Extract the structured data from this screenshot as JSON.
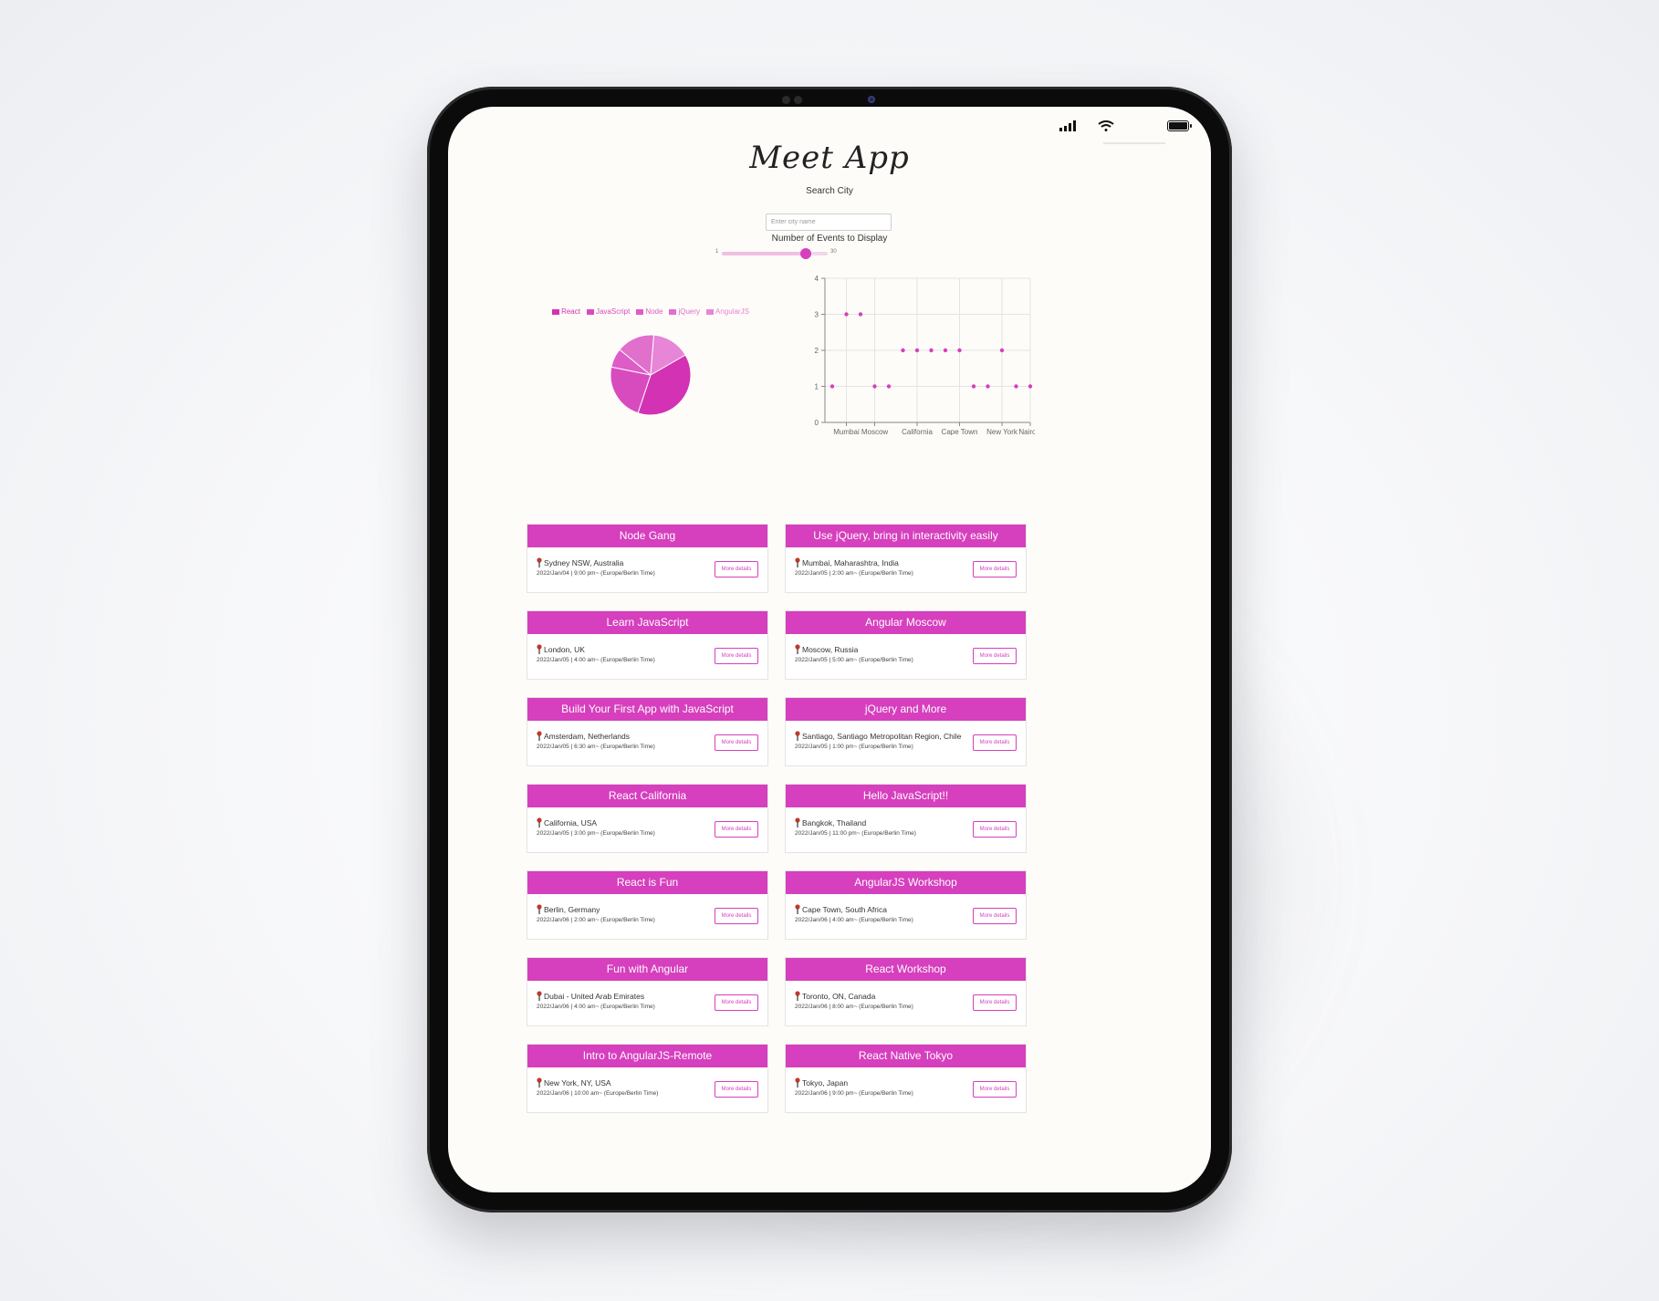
{
  "app": {
    "title": "Meet App"
  },
  "search": {
    "label": "Search City",
    "placeholder": "Enter city name"
  },
  "events_count": {
    "label": "Number of Events to Display",
    "min": "1",
    "max": "30",
    "value": 24
  },
  "colors": {
    "accent": "#d63fbd",
    "accent_light": "#efc0e2"
  },
  "chart_data": [
    {
      "type": "pie",
      "legend_position": "top",
      "categories": [
        "React",
        "JavaScript",
        "Node",
        "jQuery",
        "AngularJS"
      ],
      "values": [
        5,
        3,
        1,
        2,
        2
      ],
      "colors": [
        "#d232b3",
        "#d84bbf",
        "#dd5cc6",
        "#e16fcc",
        "#e785d6"
      ]
    },
    {
      "type": "scatter",
      "xlabel": "",
      "ylabel": "",
      "ylim": [
        0,
        4
      ],
      "yticks": [
        "0",
        "1",
        "2",
        "3",
        "4"
      ],
      "x": [
        "Sydney",
        "Mumbai",
        "Amsterdam",
        "Moscow",
        "Santiago",
        "California",
        "Berlin",
        "Bangkok",
        "Dubai",
        "Cape Town",
        "Toronto",
        "Tokyo",
        "New York",
        "London",
        "Nairobi"
      ],
      "xtick_labels": [
        {
          "index": 1,
          "label": "Mumbai"
        },
        {
          "index": 3,
          "label": "Moscow"
        },
        {
          "index": 6,
          "label": "California"
        },
        {
          "index": 9,
          "label": "Cape Town"
        },
        {
          "index": 12,
          "label": "New York"
        },
        {
          "index": 14,
          "label": "Nairobi"
        }
      ],
      "y": [
        1,
        3,
        3,
        1,
        1,
        2,
        2,
        2,
        2,
        2,
        1,
        1,
        2,
        1,
        1
      ],
      "grid": true
    }
  ],
  "events": [
    {
      "title": "Node Gang",
      "location": "Sydney NSW, Australia",
      "time": "2022/Jan/04 | 9:00 pm~ (Europe/Berlin Time)",
      "button": "More details"
    },
    {
      "title": "Use jQuery, bring in interactivity easily",
      "location": "Mumbai, Maharashtra, India",
      "time": "2022/Jan/05 | 2:00 am~ (Europe/Berlin Time)",
      "button": "More details"
    },
    {
      "title": "Learn JavaScript",
      "location": "London, UK",
      "time": "2022/Jan/05 | 4:00 am~ (Europe/Berlin Time)",
      "button": "More details"
    },
    {
      "title": "Angular Moscow",
      "location": "Moscow, Russia",
      "time": "2022/Jan/05 | 5:00 am~ (Europe/Berlin Time)",
      "button": "More details"
    },
    {
      "title": "Build Your First App with JavaScript",
      "location": "Amsterdam, Netherlands",
      "time": "2022/Jan/05 | 6:30 am~ (Europe/Berlin Time)",
      "button": "More details"
    },
    {
      "title": "jQuery and More",
      "location": "Santiago, Santiago Metropolitan Region, Chile",
      "time": "2022/Jan/05 | 1:00 pm~ (Europe/Berlin Time)",
      "button": "More details"
    },
    {
      "title": "React California",
      "location": "California, USA",
      "time": "2022/Jan/05 | 3:00 pm~ (Europe/Berlin Time)",
      "button": "More details"
    },
    {
      "title": "Hello JavaScript!!",
      "location": "Bangkok, Thailand",
      "time": "2022/Jan/05 | 11:00 pm~ (Europe/Berlin Time)",
      "button": "More details"
    },
    {
      "title": "React is Fun",
      "location": "Berlin, Germany",
      "time": "2022/Jan/06 | 2:00 am~ (Europe/Berlin Time)",
      "button": "More details"
    },
    {
      "title": "AngularJS Workshop",
      "location": "Cape Town, South Africa",
      "time": "2022/Jan/06 | 4:00 am~ (Europe/Berlin Time)",
      "button": "More details"
    },
    {
      "title": "Fun with Angular",
      "location": "Dubai - United Arab Emirates",
      "time": "2022/Jan/06 | 4:00 am~ (Europe/Berlin Time)",
      "button": "More details"
    },
    {
      "title": "React Workshop",
      "location": "Toronto, ON, Canada",
      "time": "2022/Jan/06 | 8:00 am~ (Europe/Berlin Time)",
      "button": "More details"
    },
    {
      "title": "Intro to AngularJS-Remote",
      "location": "New York, NY, USA",
      "time": "2022/Jan/06 | 10:00 am~ (Europe/Berlin Time)",
      "button": "More details"
    },
    {
      "title": "React Native Tokyo",
      "location": "Tokyo, Japan",
      "time": "2022/Jan/06 | 9:00 pm~ (Europe/Berlin Time)",
      "button": "More details"
    }
  ]
}
